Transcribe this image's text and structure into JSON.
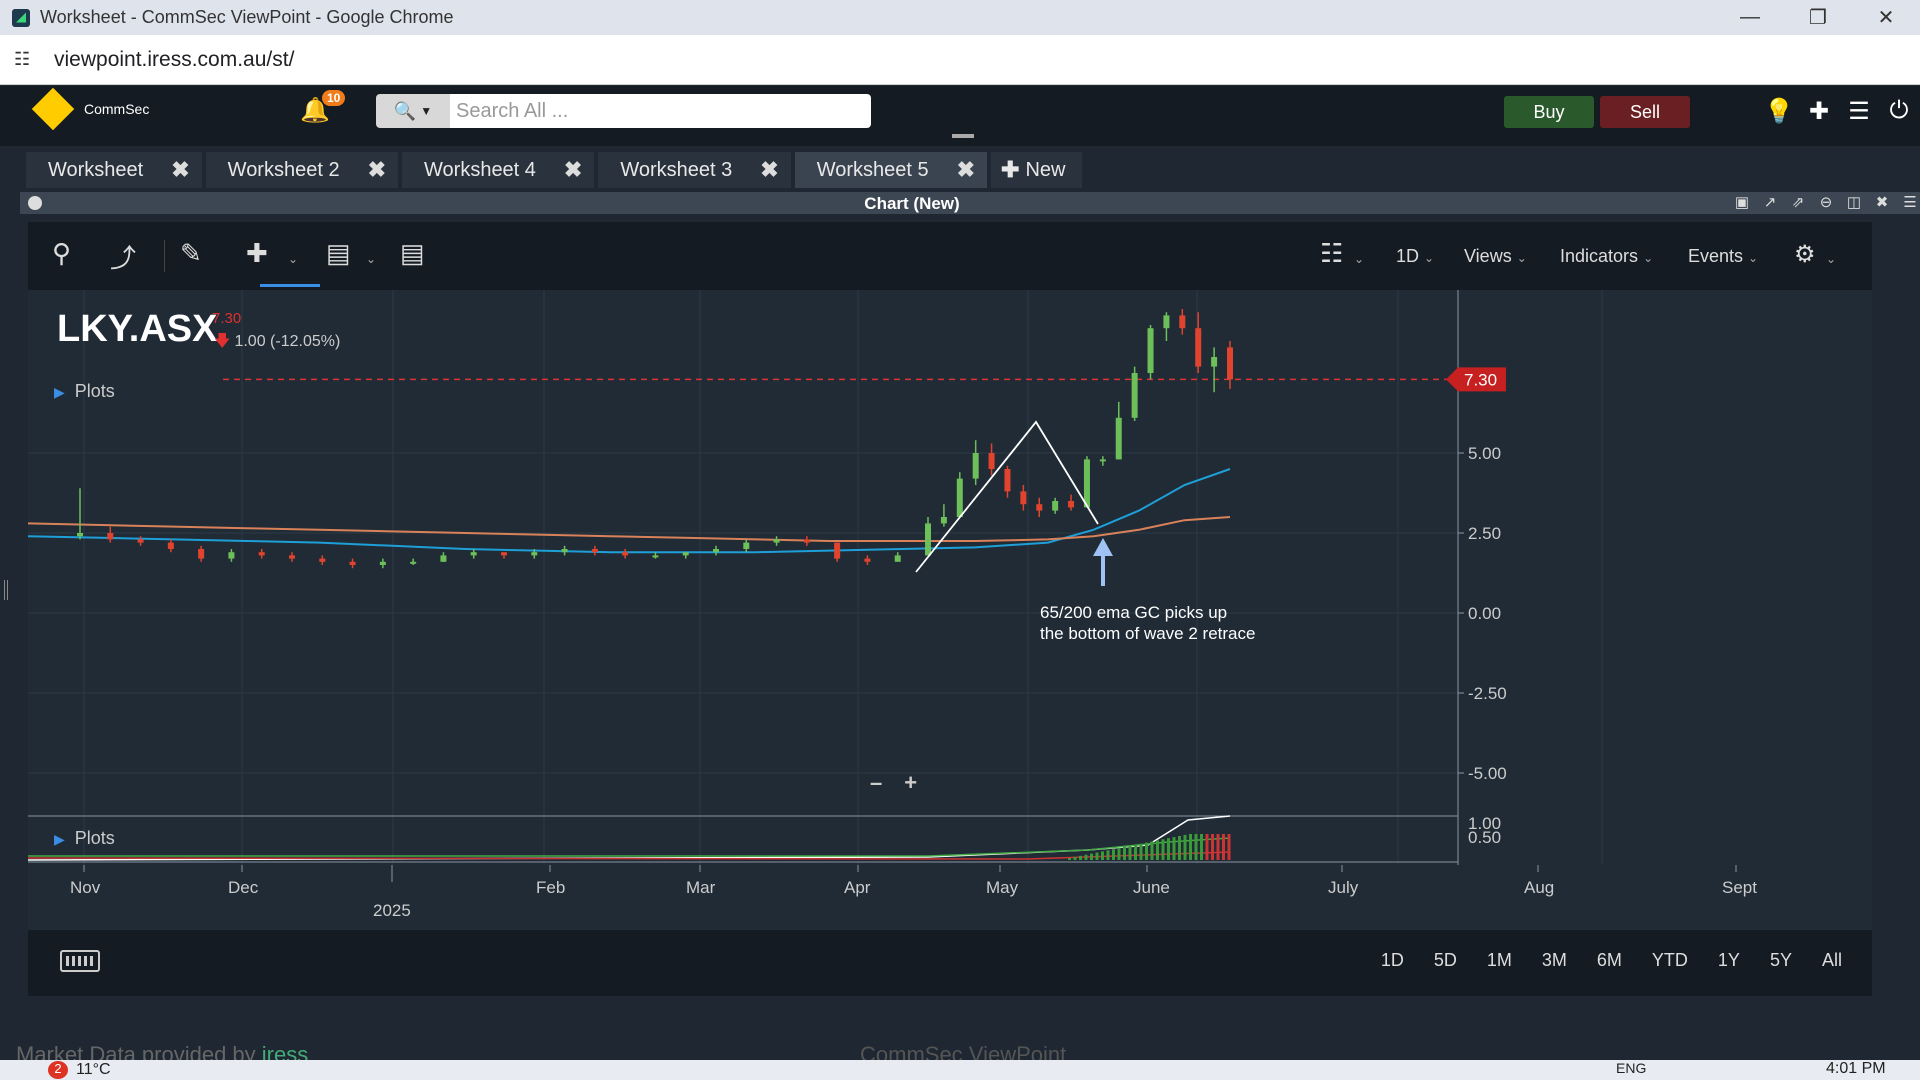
{
  "browser": {
    "window_title": "Worksheet - CommSec ViewPoint - Google Chrome",
    "url": "viewpoint.iress.com.au/st/"
  },
  "appbar": {
    "brand": "CommSec",
    "notification_count": "10",
    "search_placeholder": "Search All ...",
    "buy_label": "Buy",
    "sell_label": "Sell"
  },
  "tabs": [
    {
      "label": "Worksheet"
    },
    {
      "label": "Worksheet 2"
    },
    {
      "label": "Worksheet 4"
    },
    {
      "label": "Worksheet 3"
    },
    {
      "label": "Worksheet 5",
      "active": true
    }
  ],
  "new_tab_label": "New",
  "panel": {
    "title": "Chart (New)"
  },
  "toolbar": {
    "interval": "1D",
    "views": "Views",
    "indicators": "Indicators",
    "events": "Events"
  },
  "quote": {
    "symbol": "LKY.ASX",
    "price": "7.30",
    "change": "1.00 (-12.05%)"
  },
  "plots_label": "Plots",
  "annotation": {
    "line1": "65/200 ema GC picks up",
    "line2": "the bottom of wave 2 retrace"
  },
  "price_tag": "7.30",
  "timeframes": [
    "1D",
    "5D",
    "1M",
    "3M",
    "6M",
    "YTD",
    "1Y",
    "5Y",
    "All"
  ],
  "footer": {
    "market_data": "Market Data provided by",
    "provider": "iress",
    "center": "CommSec ViewPoint"
  },
  "taskbar": {
    "weather": "11°C",
    "weather_badge": "2",
    "lang": "ENG",
    "time": "4:01 PM"
  },
  "colors": {
    "up": "#6dbf5a",
    "down": "#e0442e",
    "ema_fast": "#1e9fd8",
    "ema_slow": "#d9825a",
    "accent": "#3a8ee6"
  },
  "chart_data": {
    "type": "candlestick",
    "y_ticks": [
      "5.00",
      "2.50",
      "0.00",
      "-2.50",
      "-5.00"
    ],
    "ylim": [
      -5.5,
      9.5
    ],
    "x_ticks": [
      "Nov",
      "Dec",
      "Feb",
      "Mar",
      "Apr",
      "May",
      "June",
      "July",
      "Aug",
      "Sept"
    ],
    "x_year_label": "2025",
    "last_price": 7.3,
    "lower_ticks": [
      "1.00",
      "0.50"
    ],
    "candles": [
      {
        "o": 2.4,
        "h": 3.9,
        "l": 2.3,
        "c": 2.5
      },
      {
        "o": 2.5,
        "h": 2.7,
        "l": 2.2,
        "c": 2.3
      },
      {
        "o": 2.3,
        "h": 2.4,
        "l": 2.1,
        "c": 2.2
      },
      {
        "o": 2.2,
        "h": 2.3,
        "l": 1.9,
        "c": 2.0
      },
      {
        "o": 2.0,
        "h": 2.1,
        "l": 1.6,
        "c": 1.7
      },
      {
        "o": 1.7,
        "h": 2.0,
        "l": 1.6,
        "c": 1.9
      },
      {
        "o": 1.9,
        "h": 2.0,
        "l": 1.7,
        "c": 1.8
      },
      {
        "o": 1.8,
        "h": 1.9,
        "l": 1.6,
        "c": 1.7
      },
      {
        "o": 1.7,
        "h": 1.8,
        "l": 1.5,
        "c": 1.6
      },
      {
        "o": 1.6,
        "h": 1.7,
        "l": 1.4,
        "c": 1.5
      },
      {
        "o": 1.5,
        "h": 1.7,
        "l": 1.4,
        "c": 1.6
      },
      {
        "o": 1.6,
        "h": 1.7,
        "l": 1.5,
        "c": 1.6
      },
      {
        "o": 1.6,
        "h": 1.9,
        "l": 1.6,
        "c": 1.8
      },
      {
        "o": 1.8,
        "h": 2.0,
        "l": 1.7,
        "c": 1.9
      },
      {
        "o": 1.9,
        "h": 1.9,
        "l": 1.7,
        "c": 1.8
      },
      {
        "o": 1.8,
        "h": 2.0,
        "l": 1.7,
        "c": 1.9
      },
      {
        "o": 1.9,
        "h": 2.1,
        "l": 1.8,
        "c": 2.0
      },
      {
        "o": 2.0,
        "h": 2.1,
        "l": 1.8,
        "c": 1.9
      },
      {
        "o": 1.9,
        "h": 2.0,
        "l": 1.7,
        "c": 1.8
      },
      {
        "o": 1.8,
        "h": 1.9,
        "l": 1.7,
        "c": 1.8
      },
      {
        "o": 1.8,
        "h": 1.9,
        "l": 1.7,
        "c": 1.9
      },
      {
        "o": 1.9,
        "h": 2.1,
        "l": 1.8,
        "c": 2.0
      },
      {
        "o": 2.0,
        "h": 2.3,
        "l": 1.9,
        "c": 2.2
      },
      {
        "o": 2.2,
        "h": 2.4,
        "l": 2.1,
        "c": 2.3
      },
      {
        "o": 2.3,
        "h": 2.4,
        "l": 2.1,
        "c": 2.2
      },
      {
        "o": 2.2,
        "h": 2.2,
        "l": 1.6,
        "c": 1.7
      },
      {
        "o": 1.7,
        "h": 1.8,
        "l": 1.5,
        "c": 1.6
      },
      {
        "o": 1.6,
        "h": 1.9,
        "l": 1.6,
        "c": 1.8
      },
      {
        "o": 1.8,
        "h": 2.2,
        "l": 1.8,
        "c": 2.1
      },
      {
        "o": 2.1,
        "h": 3.0,
        "l": 2.0,
        "c": 2.8
      },
      {
        "o": 2.8,
        "h": 3.4,
        "l": 2.7,
        "c": 3.0
      },
      {
        "o": 3.0,
        "h": 4.4,
        "l": 3.0,
        "c": 4.2
      },
      {
        "o": 4.2,
        "h": 5.4,
        "l": 4.0,
        "c": 5.0
      },
      {
        "o": 5.0,
        "h": 5.3,
        "l": 4.3,
        "c": 4.5
      },
      {
        "o": 4.5,
        "h": 4.6,
        "l": 3.6,
        "c": 3.8
      },
      {
        "o": 3.8,
        "h": 4.0,
        "l": 3.2,
        "c": 3.4
      },
      {
        "o": 3.4,
        "h": 3.6,
        "l": 3.0,
        "c": 3.2
      },
      {
        "o": 3.2,
        "h": 3.6,
        "l": 3.1,
        "c": 3.5
      },
      {
        "o": 3.5,
        "h": 3.7,
        "l": 3.2,
        "c": 3.3
      },
      {
        "o": 3.3,
        "h": 4.9,
        "l": 3.3,
        "c": 4.8
      },
      {
        "o": 4.8,
        "h": 4.9,
        "l": 4.6,
        "c": 4.8
      },
      {
        "o": 4.8,
        "h": 6.6,
        "l": 4.8,
        "c": 6.1
      },
      {
        "o": 6.1,
        "h": 7.7,
        "l": 6.0,
        "c": 7.5
      },
      {
        "o": 7.5,
        "h": 9.0,
        "l": 7.3,
        "c": 8.9
      },
      {
        "o": 8.9,
        "h": 9.4,
        "l": 8.5,
        "c": 9.3
      },
      {
        "o": 9.3,
        "h": 9.5,
        "l": 8.7,
        "c": 8.9
      },
      {
        "o": 8.9,
        "h": 9.4,
        "l": 7.5,
        "c": 7.7
      },
      {
        "o": 7.7,
        "h": 8.3,
        "l": 6.9,
        "c": 8.0
      },
      {
        "o": 8.3,
        "h": 8.5,
        "l": 7.0,
        "c": 7.3
      }
    ],
    "ema_fast": [
      2.4,
      2.35,
      2.3,
      2.25,
      2.2,
      2.1,
      2.0,
      1.95,
      1.9,
      1.9,
      1.9,
      1.95,
      2.0,
      2.05,
      2.2,
      2.6,
      3.2,
      4.0,
      4.5
    ],
    "ema_slow": [
      2.8,
      2.75,
      2.7,
      2.65,
      2.6,
      2.55,
      2.5,
      2.45,
      2.4,
      2.35,
      2.3,
      2.25,
      2.25,
      2.25,
      2.3,
      2.4,
      2.6,
      2.9,
      3.0
    ]
  }
}
